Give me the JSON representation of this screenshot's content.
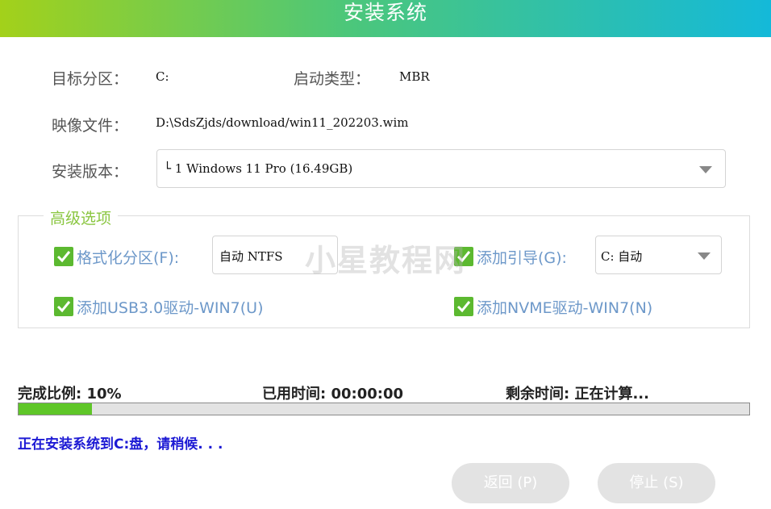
{
  "header": {
    "title": "安装系统"
  },
  "info": {
    "target_partition_label": "目标分区：",
    "target_partition_value": "C:",
    "boot_type_label": "启动类型：",
    "boot_type_value": "MBR",
    "image_file_label": "映像文件：",
    "image_file_value": "D:\\SdsZjds/download/win11_202203.wim",
    "install_version_label": "安装版本：",
    "install_version_value": "└ 1 Windows 11 Pro (16.49GB)"
  },
  "advanced": {
    "legend": "高级选项",
    "format_partition": {
      "label": "格式化分区(F):",
      "checked": true,
      "fs_value": "自动 NTFS"
    },
    "add_boot": {
      "label": "添加引导(G):",
      "checked": true,
      "drive_value": "C: 自动"
    },
    "usb_driver": {
      "label": "添加USB3.0驱动-WIN7(U)",
      "checked": true
    },
    "nvme_driver": {
      "label": "添加NVME驱动-WIN7(N)",
      "checked": true
    }
  },
  "watermark": "小星教程网",
  "progress": {
    "ratio_label": "完成比例: 10%",
    "elapsed_label": "已用时间: 00:00:00",
    "remaining_label": "剩余时间: 正在计算...",
    "fraction": 0.1
  },
  "status_text": "正在安装系统到C:盘，请稍候. . .",
  "buttons": {
    "back": "返回 (P)",
    "stop": "停止 (S)"
  },
  "colors": {
    "accent_green": "#5cb930",
    "status_blue": "#1d1ad4",
    "label_blue": "#6d98c9"
  }
}
